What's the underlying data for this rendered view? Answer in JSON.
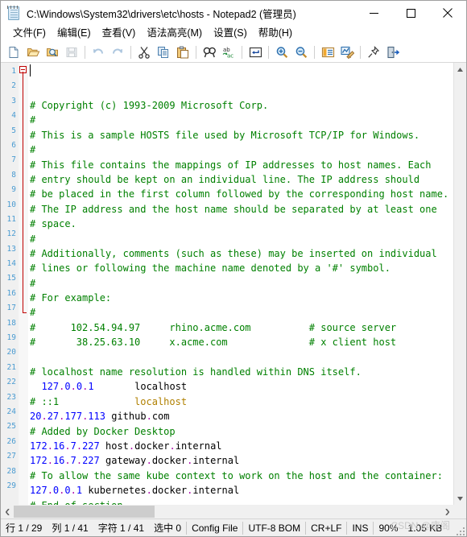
{
  "window": {
    "title": "C:\\Windows\\System32\\drivers\\etc\\hosts - Notepad2 (管理员)",
    "icon": "notepad-icon",
    "minimize_label": "—",
    "maximize_label": "□",
    "close_label": "✕"
  },
  "menu": {
    "items": [
      {
        "label": "文件(F)",
        "name": "menu-file"
      },
      {
        "label": "编辑(E)",
        "name": "menu-edit"
      },
      {
        "label": "查看(V)",
        "name": "menu-view"
      },
      {
        "label": "语法高亮(M)",
        "name": "menu-syntax"
      },
      {
        "label": "设置(S)",
        "name": "menu-settings"
      },
      {
        "label": "帮助(H)",
        "name": "menu-help"
      }
    ]
  },
  "toolbar": {
    "buttons": [
      {
        "name": "new-file-icon",
        "title": "新建"
      },
      {
        "name": "open-file-icon",
        "title": "打开"
      },
      {
        "name": "file-browser-icon",
        "title": "浏览"
      },
      {
        "name": "save-icon",
        "title": "保存",
        "disabled": true
      },
      {
        "sep": true
      },
      {
        "name": "undo-icon",
        "title": "撤销",
        "disabled": true
      },
      {
        "name": "redo-icon",
        "title": "重做",
        "disabled": true
      },
      {
        "sep": true
      },
      {
        "name": "cut-icon",
        "title": "剪切"
      },
      {
        "name": "copy-icon",
        "title": "复制"
      },
      {
        "name": "paste-icon",
        "title": "粘贴"
      },
      {
        "sep": true
      },
      {
        "name": "find-icon",
        "title": "查找"
      },
      {
        "name": "replace-icon",
        "title": "替换"
      },
      {
        "sep": true
      },
      {
        "name": "word-wrap-icon",
        "title": "自动换行"
      },
      {
        "sep": true
      },
      {
        "name": "zoom-in-icon",
        "title": "放大"
      },
      {
        "name": "zoom-out-icon",
        "title": "缩小"
      },
      {
        "sep": true
      },
      {
        "name": "scheme-icon",
        "title": "配色方案"
      },
      {
        "name": "customize-schemes-icon",
        "title": "自定义方案"
      },
      {
        "sep": true
      },
      {
        "name": "always-on-top-icon",
        "title": "总在最前"
      },
      {
        "name": "exit-icon",
        "title": "退出"
      }
    ]
  },
  "editor": {
    "total_lines": 29,
    "fold_marker_line": 1,
    "fold_end_line": 17,
    "caret_line": 1,
    "caret_col": 1,
    "colors": {
      "comment": "#008000",
      "ip": "#0000ff",
      "hostname": "#000000",
      "dot": "#aa00aa",
      "identifier": "#b08000",
      "line_number": "#4a9bd1",
      "gutter_bg": "#f0f0f0",
      "fold_line": "#c00000"
    },
    "lines": [
      {
        "n": 1,
        "tokens": [
          {
            "t": "# Copyright (c) 1993-2009 Microsoft Corp.",
            "c": "comment"
          }
        ]
      },
      {
        "n": 2,
        "tokens": [
          {
            "t": "#",
            "c": "comment"
          }
        ]
      },
      {
        "n": 3,
        "tokens": [
          {
            "t": "# This is a sample HOSTS file used by Microsoft TCP/IP for Windows.",
            "c": "comment"
          }
        ]
      },
      {
        "n": 4,
        "tokens": [
          {
            "t": "#",
            "c": "comment"
          }
        ]
      },
      {
        "n": 5,
        "tokens": [
          {
            "t": "# This file contains the mappings of IP addresses to host names. Each",
            "c": "comment"
          }
        ]
      },
      {
        "n": 6,
        "tokens": [
          {
            "t": "# entry should be kept on an individual line. The IP address should",
            "c": "comment"
          }
        ]
      },
      {
        "n": 7,
        "tokens": [
          {
            "t": "# be placed in the first column followed by the corresponding host name.",
            "c": "comment"
          }
        ]
      },
      {
        "n": 8,
        "tokens": [
          {
            "t": "# The IP address and the host name should be separated by at least one",
            "c": "comment"
          }
        ]
      },
      {
        "n": 9,
        "tokens": [
          {
            "t": "# space.",
            "c": "comment"
          }
        ]
      },
      {
        "n": 10,
        "tokens": [
          {
            "t": "#",
            "c": "comment"
          }
        ]
      },
      {
        "n": 11,
        "tokens": [
          {
            "t": "# Additionally, comments (such as these) may be inserted on individual",
            "c": "comment"
          }
        ]
      },
      {
        "n": 12,
        "tokens": [
          {
            "t": "# lines or following the machine name denoted by a '#' symbol.",
            "c": "comment"
          }
        ]
      },
      {
        "n": 13,
        "tokens": [
          {
            "t": "#",
            "c": "comment"
          }
        ]
      },
      {
        "n": 14,
        "tokens": [
          {
            "t": "# For example:",
            "c": "comment"
          }
        ]
      },
      {
        "n": 15,
        "tokens": [
          {
            "t": "#",
            "c": "comment"
          }
        ]
      },
      {
        "n": 16,
        "tokens": [
          {
            "t": "#      102.54.94.97     rhino.acme.com          # source server",
            "c": "comment"
          }
        ]
      },
      {
        "n": 17,
        "tokens": [
          {
            "t": "#       38.25.63.10     x.acme.com              # x client host",
            "c": "comment"
          }
        ]
      },
      {
        "n": 18,
        "tokens": [
          {
            "t": "",
            "c": "comment"
          }
        ]
      },
      {
        "n": 19,
        "tokens": [
          {
            "t": "# localhost name resolution is handled within DNS itself.",
            "c": "comment"
          }
        ]
      },
      {
        "n": 20,
        "tokens": [
          {
            "t": "  ",
            "c": "plain"
          },
          {
            "t": "127",
            "c": "ip"
          },
          {
            "t": ".",
            "c": "dot"
          },
          {
            "t": "0",
            "c": "ip"
          },
          {
            "t": ".",
            "c": "dot"
          },
          {
            "t": "0",
            "c": "ip"
          },
          {
            "t": ".",
            "c": "dot"
          },
          {
            "t": "1",
            "c": "ip"
          },
          {
            "t": "       ",
            "c": "plain"
          },
          {
            "t": "localhost",
            "c": "hostname"
          }
        ]
      },
      {
        "n": 21,
        "tokens": [
          {
            "t": "# ::1",
            "c": "comment"
          },
          {
            "t": "             ",
            "c": "plain"
          },
          {
            "t": "localhost",
            "c": "identifier"
          }
        ]
      },
      {
        "n": 22,
        "tokens": [
          {
            "t": "20",
            "c": "ip"
          },
          {
            "t": ".",
            "c": "dot"
          },
          {
            "t": "27",
            "c": "ip"
          },
          {
            "t": ".",
            "c": "dot"
          },
          {
            "t": "177",
            "c": "ip"
          },
          {
            "t": ".",
            "c": "dot"
          },
          {
            "t": "113",
            "c": "ip"
          },
          {
            "t": " ",
            "c": "plain"
          },
          {
            "t": "github",
            "c": "hostname"
          },
          {
            "t": ".",
            "c": "dot"
          },
          {
            "t": "com",
            "c": "hostname"
          }
        ]
      },
      {
        "n": 23,
        "tokens": [
          {
            "t": "# Added by Docker Desktop",
            "c": "comment"
          }
        ]
      },
      {
        "n": 24,
        "tokens": [
          {
            "t": "172",
            "c": "ip"
          },
          {
            "t": ".",
            "c": "dot"
          },
          {
            "t": "16",
            "c": "ip"
          },
          {
            "t": ".",
            "c": "dot"
          },
          {
            "t": "7",
            "c": "ip"
          },
          {
            "t": ".",
            "c": "dot"
          },
          {
            "t": "227",
            "c": "ip"
          },
          {
            "t": " ",
            "c": "plain"
          },
          {
            "t": "host",
            "c": "hostname"
          },
          {
            "t": ".",
            "c": "dot"
          },
          {
            "t": "docker",
            "c": "hostname"
          },
          {
            "t": ".",
            "c": "dot"
          },
          {
            "t": "internal",
            "c": "hostname"
          }
        ]
      },
      {
        "n": 25,
        "tokens": [
          {
            "t": "172",
            "c": "ip"
          },
          {
            "t": ".",
            "c": "dot"
          },
          {
            "t": "16",
            "c": "ip"
          },
          {
            "t": ".",
            "c": "dot"
          },
          {
            "t": "7",
            "c": "ip"
          },
          {
            "t": ".",
            "c": "dot"
          },
          {
            "t": "227",
            "c": "ip"
          },
          {
            "t": " ",
            "c": "plain"
          },
          {
            "t": "gateway",
            "c": "hostname"
          },
          {
            "t": ".",
            "c": "dot"
          },
          {
            "t": "docker",
            "c": "hostname"
          },
          {
            "t": ".",
            "c": "dot"
          },
          {
            "t": "internal",
            "c": "hostname"
          }
        ]
      },
      {
        "n": 26,
        "tokens": [
          {
            "t": "# To allow the same kube context to work on the host and the container:",
            "c": "comment"
          }
        ]
      },
      {
        "n": 27,
        "tokens": [
          {
            "t": "127",
            "c": "ip"
          },
          {
            "t": ".",
            "c": "dot"
          },
          {
            "t": "0",
            "c": "ip"
          },
          {
            "t": ".",
            "c": "dot"
          },
          {
            "t": "0",
            "c": "ip"
          },
          {
            "t": ".",
            "c": "dot"
          },
          {
            "t": "1",
            "c": "ip"
          },
          {
            "t": " ",
            "c": "plain"
          },
          {
            "t": "kubernetes",
            "c": "hostname"
          },
          {
            "t": ".",
            "c": "dot"
          },
          {
            "t": "docker",
            "c": "hostname"
          },
          {
            "t": ".",
            "c": "dot"
          },
          {
            "t": "internal",
            "c": "hostname"
          }
        ]
      },
      {
        "n": 28,
        "tokens": [
          {
            "t": "# End of section",
            "c": "comment"
          }
        ]
      },
      {
        "n": 29,
        "tokens": [
          {
            "t": "",
            "c": "plain"
          }
        ]
      }
    ]
  },
  "scrollbars": {
    "horizontal_thumb_percent": 33,
    "up_arrow": "▲",
    "down_arrow": "▼",
    "left_arrow": "❮",
    "right_arrow": "❯"
  },
  "statusbar": {
    "line_info": "行 1 / 29",
    "col_info": "列 1 / 41",
    "char_info": "字符 1 / 41",
    "selection_info": "选中 0",
    "file_type": "Config File",
    "encoding": "UTF-8 BOM",
    "line_ending": "CR+LF",
    "insert_mode": "INS",
    "zoom": "90%",
    "file_size": "1.05 KB"
  },
  "watermark": {
    "text": "CSDN @康阁"
  }
}
